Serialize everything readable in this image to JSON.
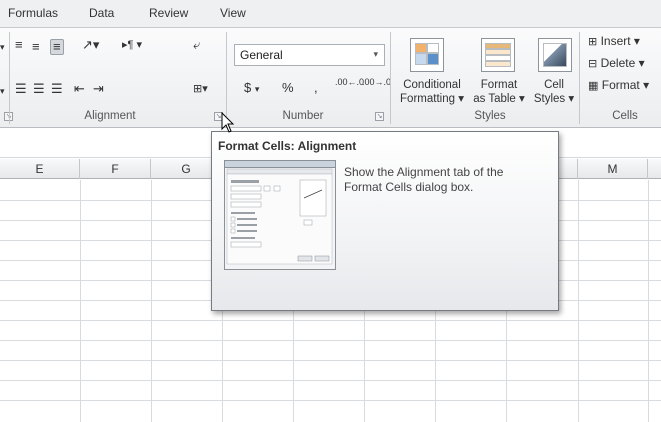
{
  "ribbon_tabs": [
    "Formulas",
    "Data",
    "Review",
    "View"
  ],
  "groups": {
    "alignment": {
      "label": "Alignment"
    },
    "number": {
      "label": "Number",
      "format_value": "General",
      "tools": [
        "$",
        "%",
        ",",
        ".00←.0",
        ".00→.0"
      ]
    },
    "styles": {
      "label": "Styles",
      "conditional_line1": "Conditional",
      "conditional_line2": "Formatting ▾",
      "format_table_line1": "Format",
      "format_table_line2": "as Table ▾",
      "cell_styles_line1": "Cell",
      "cell_styles_line2": "Styles ▾"
    },
    "cells": {
      "label": "Cells",
      "insert": "Insert ▾",
      "delete": "Delete ▾",
      "format": "Format ▾"
    }
  },
  "columns": [
    "E",
    "F",
    "G",
    "",
    "",
    "",
    "",
    "M"
  ],
  "tooltip": {
    "title": "Format Cells: Alignment",
    "description": "Show the Alignment tab of the Format Cells dialog box."
  }
}
